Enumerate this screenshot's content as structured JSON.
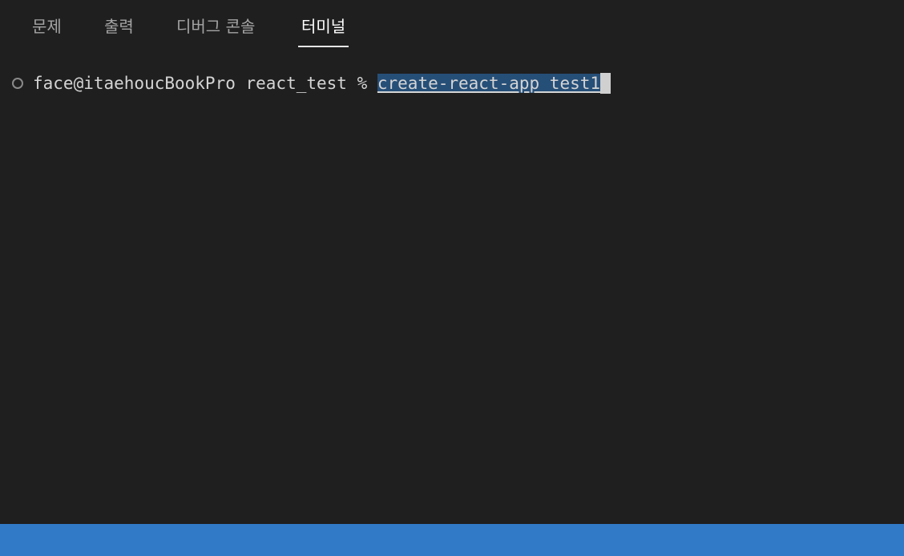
{
  "tabs": [
    {
      "label": "문제"
    },
    {
      "label": "출력"
    },
    {
      "label": "디버그 콘솔"
    },
    {
      "label": "터미널"
    }
  ],
  "active_tab": "터미널",
  "terminal": {
    "prompt": "face@itaehoucBookPro react_test % ",
    "command": "create-react-app test1"
  },
  "colors": {
    "background": "#1f1f1f",
    "selection": "#264f78",
    "statusbar": "#307ac7"
  }
}
